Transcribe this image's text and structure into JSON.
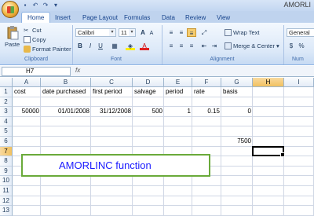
{
  "app": {
    "title": "AMORLI"
  },
  "ribbon": {
    "tabs": [
      "Home",
      "Insert",
      "Page Layout",
      "Formulas",
      "Data",
      "Review",
      "View"
    ],
    "clipboard": {
      "paste": "Paste",
      "cut": "Cut",
      "copy": "Copy",
      "format_painter": "Format Painter",
      "label": "Clipboard"
    },
    "font": {
      "name": "Calibri",
      "size": "11",
      "label": "Font",
      "bold": "B",
      "italic": "I",
      "underline": "U",
      "grow": "A",
      "shrink": "A"
    },
    "alignment": {
      "wrap": "Wrap Text",
      "merge": "Merge & Center",
      "label": "Alignment"
    },
    "number": {
      "format": "General",
      "label": "Num"
    }
  },
  "formula_bar": {
    "name_box": "H7",
    "fx": "fx",
    "value": ""
  },
  "columns": [
    "A",
    "B",
    "C",
    "D",
    "E",
    "F",
    "G",
    "H",
    "I"
  ],
  "rows": [
    "1",
    "2",
    "3",
    "4",
    "5",
    "6",
    "7",
    "8",
    "9",
    "10",
    "11",
    "12",
    "13"
  ],
  "cells": {
    "A1": "cost",
    "B1": "date purchased",
    "C1": "first period",
    "D1": "salvage",
    "E1": "period",
    "F1": "rate",
    "G1": "basis",
    "A3": "50000",
    "B3": "01/01/2008",
    "C3": "31/12/2008",
    "D3": "500",
    "E3": "1",
    "F3": "0.15",
    "G3": "0",
    "G6": "7500"
  },
  "callout": {
    "text": "AMORLINC function"
  },
  "colors": {
    "accent": "#15428b",
    "selection": "#f1c15f",
    "callout_border": "#6aaa3a",
    "callout_text": "#1a1aff"
  }
}
